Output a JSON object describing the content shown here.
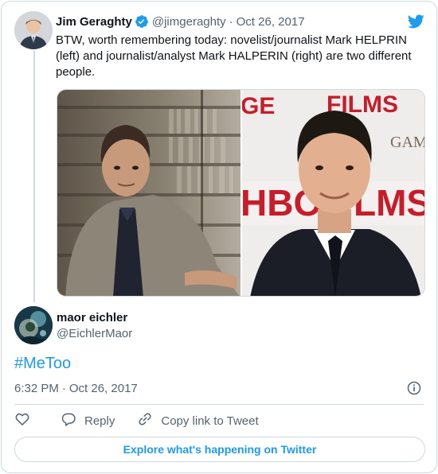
{
  "parent_tweet": {
    "author_name": "Jim Geraghty",
    "handle": "@jimgeraghty",
    "separator": "·",
    "date": "Oct 26, 2017",
    "text": "BTW, worth remembering today: novelist/journalist Mark HELPRIN (left) and journalist/analyst Mark HALPERIN (right) are two different people.",
    "verified": true,
    "media_right_signage": {
      "top_left": "GE",
      "top_right": "FILMS",
      "mid_right": "GAM",
      "bottom_left": "HBO",
      "bottom_right": "LMS"
    }
  },
  "main_tweet": {
    "author_name": "maor eichler",
    "handle": "@EichlerMaor",
    "text": "#MeToo",
    "time": "6:32 PM",
    "separator": "·",
    "date": "Oct 26, 2017"
  },
  "actions": {
    "reply_label": "Reply",
    "copy_link_label": "Copy link to Tweet"
  },
  "explore_label": "Explore what's happening on Twitter",
  "colors": {
    "accent": "#1d9bf0",
    "text_primary": "#0f1419",
    "text_secondary": "#536471",
    "border": "#cfd9de"
  },
  "icons": [
    "twitter-bird-icon",
    "verified-badge-icon",
    "info-icon",
    "heart-icon",
    "reply-icon",
    "copy-link-icon"
  ]
}
